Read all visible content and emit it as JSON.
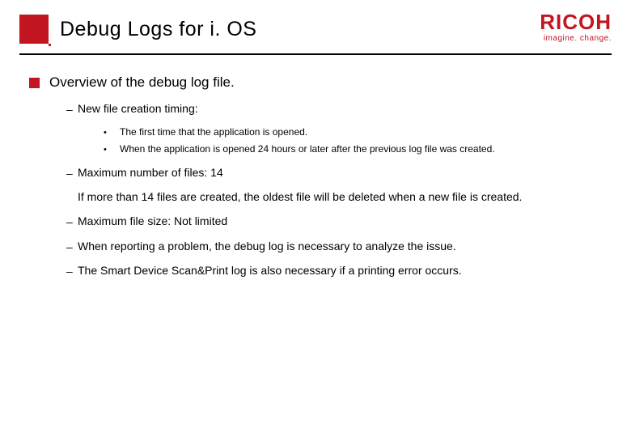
{
  "header": {
    "title": "Debug Logs for i. OS",
    "logo_main": "RICOH",
    "logo_tag": "imagine. change."
  },
  "content": {
    "lvl1": "Overview of the debug log file.",
    "items": [
      {
        "text": "New file creation timing:",
        "sub": [
          "The first time that the application is opened.",
          "When the application is opened 24 hours or later after the previous log file was created."
        ]
      },
      {
        "text": "Maximum number of files: 14",
        "note": "If more than 14 files are created, the oldest file will be deleted when a new file is created."
      },
      {
        "text": "Maximum file size: Not limited"
      },
      {
        "text": "When reporting a problem, the debug log is necessary to analyze the issue."
      },
      {
        "text": "The Smart Device Scan&Print log is also necessary if a printing error occurs."
      }
    ]
  }
}
